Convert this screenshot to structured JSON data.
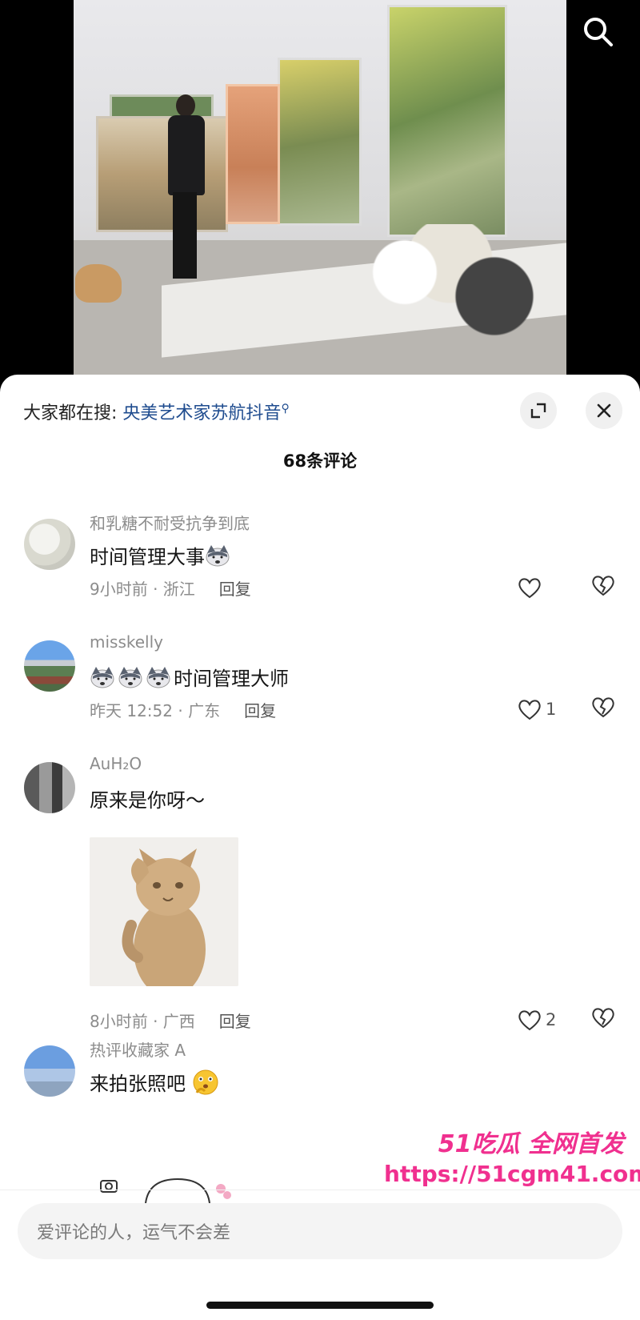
{
  "hot_search": {
    "prefix": "大家都在搜:",
    "term": "央美艺术家苏航抖音"
  },
  "comments_header": {
    "title": "68条评论"
  },
  "comments": [
    {
      "username": "和乳糖不耐受抗争到底",
      "text": "时间管理大事",
      "time_location": "9小时前 · 浙江",
      "reply_label": "回复",
      "likes": "",
      "emoji": "husky-emoji"
    },
    {
      "username": "misskelly",
      "text": "时间管理大师",
      "time_location": "昨天 12:52 · 广东",
      "reply_label": "回复",
      "likes": "1",
      "emoji": "husky-emoji"
    },
    {
      "username": "AuH₂O",
      "text": "原来是你呀～",
      "time_location": "8小时前 · 广西",
      "reply_label": "回复",
      "likes": "2",
      "sticker": "cat-salute-sticker"
    },
    {
      "username": "热评收藏家 A",
      "text": "来拍张照吧",
      "emoji": "thinking-face-emoji"
    }
  ],
  "watermark": {
    "line1": "51吃瓜 全网首发",
    "line2": "https://51cgm41.com"
  },
  "input": {
    "placeholder": "爱评论的人，运气不会差"
  },
  "colors": {
    "link_blue": "#1f4c8f",
    "watermark_pink": "#f0308f",
    "muted_text": "#8c8c8c"
  }
}
